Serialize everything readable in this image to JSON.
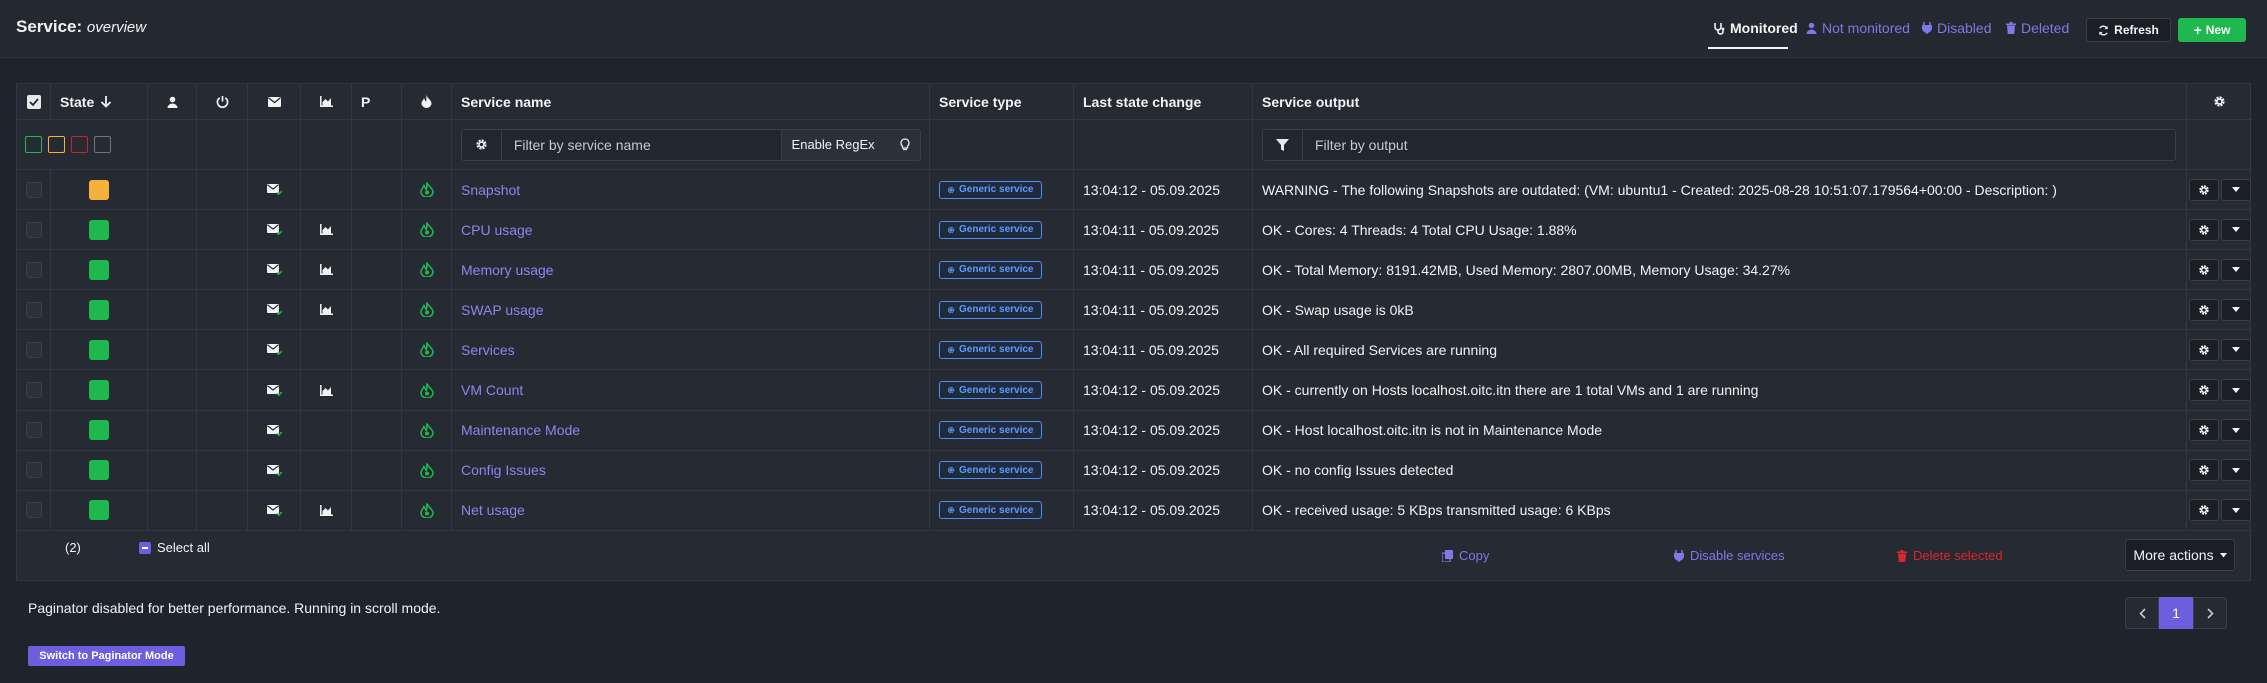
{
  "header": {
    "title": "Service:",
    "subtitle": "overview",
    "tabs": [
      {
        "label": "Monitored",
        "icon": "stethoscope-icon",
        "active": true
      },
      {
        "label": "Not monitored",
        "icon": "user-icon",
        "active": false
      },
      {
        "label": "Disabled",
        "icon": "plug-icon",
        "active": false
      },
      {
        "label": "Deleted",
        "icon": "trash-icon",
        "active": false
      }
    ],
    "refresh_label": "Refresh",
    "new_label": "New"
  },
  "table": {
    "columns": {
      "state": "State",
      "passive": "P",
      "service_name": "Service name",
      "service_type": "Service type",
      "last_state_change": "Last state change",
      "service_output": "Service output"
    },
    "filters": {
      "service_name_placeholder": "Filter by service name",
      "regex_label": "Enable RegEx",
      "output_placeholder": "Filter by output",
      "state_colors": [
        "#1fb84f",
        "#f4b23c",
        "#c9232c",
        "#6f7480"
      ]
    },
    "rows": [
      {
        "state": "warning",
        "state_color": "#f4b23c",
        "graph": false,
        "name": "Snapshot",
        "type": "Generic service",
        "changed": "13:04:12 - 05.09.2025",
        "output": "WARNING - The following Snapshots are outdated: (VM: ubuntu1 - Created: 2025-08-28 10:51:07.179564+00:00 - Description: )"
      },
      {
        "state": "ok",
        "state_color": "#1fb84f",
        "graph": true,
        "name": "CPU usage",
        "type": "Generic service",
        "changed": "13:04:11 - 05.09.2025",
        "output": "OK - Cores: 4 Threads: 4 Total CPU Usage: 1.88%"
      },
      {
        "state": "ok",
        "state_color": "#1fb84f",
        "graph": true,
        "name": "Memory usage",
        "type": "Generic service",
        "changed": "13:04:11 - 05.09.2025",
        "output": "OK - Total Memory: 8191.42MB, Used Memory: 2807.00MB, Memory Usage: 34.27%"
      },
      {
        "state": "ok",
        "state_color": "#1fb84f",
        "graph": true,
        "name": "SWAP usage",
        "type": "Generic service",
        "changed": "13:04:11 - 05.09.2025",
        "output": "OK - Swap usage is 0kB"
      },
      {
        "state": "ok",
        "state_color": "#1fb84f",
        "graph": false,
        "name": "Services",
        "type": "Generic service",
        "changed": "13:04:11 - 05.09.2025",
        "output": "OK - All required Services are running"
      },
      {
        "state": "ok",
        "state_color": "#1fb84f",
        "graph": true,
        "name": "VM Count",
        "type": "Generic service",
        "changed": "13:04:12 - 05.09.2025",
        "output": "OK - currently on Hosts localhost.oitc.itn there are 1 total VMs and 1 are running"
      },
      {
        "state": "ok",
        "state_color": "#1fb84f",
        "graph": false,
        "name": "Maintenance Mode",
        "type": "Generic service",
        "changed": "13:04:12 - 05.09.2025",
        "output": "OK - Host localhost.oitc.itn is not in Maintenance Mode"
      },
      {
        "state": "ok",
        "state_color": "#1fb84f",
        "graph": false,
        "name": "Config Issues",
        "type": "Generic service",
        "changed": "13:04:12 - 05.09.2025",
        "output": "OK - no config Issues detected"
      },
      {
        "state": "ok",
        "state_color": "#1fb84f",
        "graph": true,
        "name": "Net usage",
        "type": "Generic service",
        "changed": "13:04:12 - 05.09.2025",
        "output": "OK - received usage: 5 KBps transmitted usage: 6 KBps"
      }
    ]
  },
  "footer": {
    "selected_count": "(2)",
    "select_all_label": "Select all",
    "copy_label": "Copy",
    "disable_label": "Disable services",
    "delete_label": "Delete selected",
    "more_actions_label": "More actions"
  },
  "paginator": {
    "note": "Paginator disabled for better performance. Running in scroll mode.",
    "switch_label": "Switch to Paginator Mode",
    "current_page": "1"
  },
  "colors": {
    "accent": "#7d79e6",
    "ok": "#1fb84f",
    "warning": "#f4b23c",
    "critical": "#c9232c",
    "danger_text": "#d9262f"
  }
}
